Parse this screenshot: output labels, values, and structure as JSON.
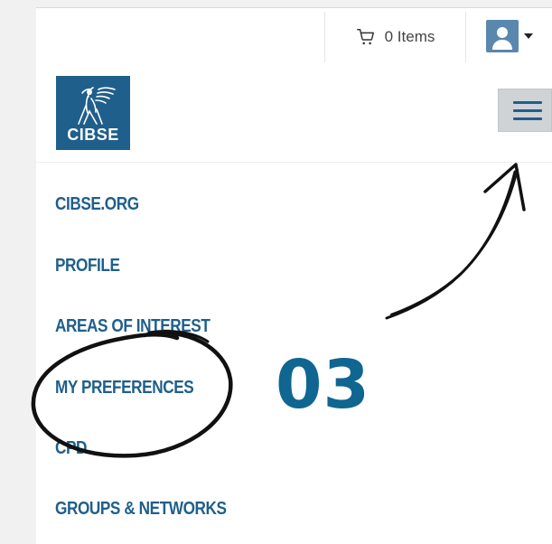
{
  "header": {
    "cart_label": "0 Items",
    "cart_icon": "shopping-cart-icon",
    "user_icon": "user-avatar-icon",
    "menu_icon": "hamburger-menu-icon"
  },
  "logo": {
    "text": "CIBSE",
    "brand_color": "#1f5f8b"
  },
  "menu": {
    "items": [
      {
        "label": "CIBSE.ORG"
      },
      {
        "label": "PROFILE"
      },
      {
        "label": "AREAS OF INTEREST"
      },
      {
        "label": "MY PREFERENCES"
      },
      {
        "label": "CPD"
      },
      {
        "label": "GROUPS & NETWORKS"
      }
    ]
  },
  "annotation": {
    "step_number": "03",
    "color": "#0f6690"
  }
}
